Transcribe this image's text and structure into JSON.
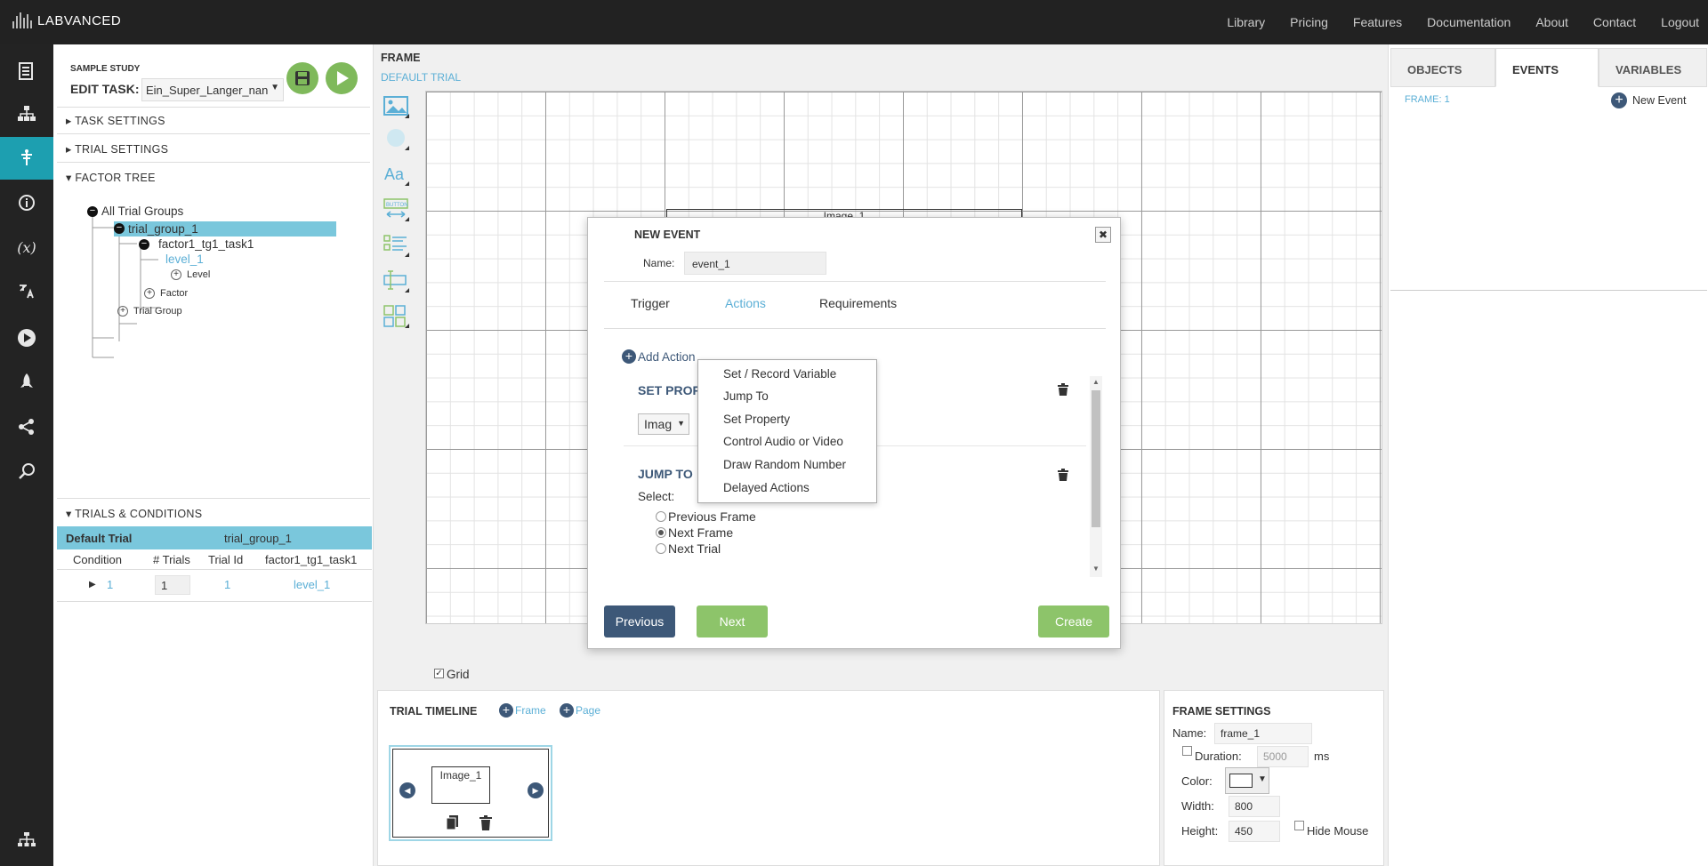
{
  "brand": {
    "name": "LABVANCED"
  },
  "topnav": [
    "Library",
    "Pricing",
    "Features",
    "Documentation",
    "About",
    "Contact",
    "Logout"
  ],
  "rail_icons": [
    "task-list-icon",
    "hierarchy-icon",
    "task-editor-icon",
    "info-icon",
    "variable-icon",
    "translate-icon",
    "play-icon",
    "rocket-icon",
    "share-icon",
    "search-icon",
    "sitemap-icon"
  ],
  "study": {
    "label": "SAMPLE STUDY",
    "edit_task_label": "EDIT TASK:",
    "task_name": "Ein_Super_Langer_nan"
  },
  "sections": {
    "task_settings": "TASK SETTINGS",
    "trial_settings": "TRIAL SETTINGS",
    "factor_tree": "FACTOR TREE",
    "trials_conditions": "TRIALS & CONDITIONS"
  },
  "factor_tree": {
    "root": "All Trial Groups",
    "group": "trial_group_1",
    "factor": "factor1_tg1_task1",
    "level": "level_1",
    "add_level": "Level",
    "add_factor": "Factor",
    "add_trial_group": "Trial Group"
  },
  "trials_table": {
    "group_title": "Default Trial",
    "group_name": "trial_group_1",
    "headers": [
      "Condition",
      "# Trials",
      "Trial Id",
      "factor1_tg1_task1"
    ],
    "rows": [
      {
        "condition": "1",
        "trials": "1",
        "trial_id": "1",
        "factor": "level_1"
      }
    ]
  },
  "frame": {
    "title": "FRAME",
    "subtitle": "DEFAULT TRIAL",
    "image_label": "Image_1",
    "grid_label": "Grid"
  },
  "right_tabs": [
    "OBJECTS",
    "EVENTS",
    "VARIABLES"
  ],
  "events_panel": {
    "frame_label": "FRAME: 1",
    "new_event": "New Event"
  },
  "modal": {
    "title": "NEW EVENT",
    "name_label": "Name:",
    "name_value": "event_1",
    "tabs": [
      "Trigger",
      "Actions",
      "Requirements"
    ],
    "add_action": "Add Action",
    "set_property_title": "SET PROP",
    "set_property_select": "Imag",
    "jump_to_title": "JUMP TO",
    "select_label": "Select:",
    "radio_options": [
      {
        "label": "Previous Frame",
        "checked": false
      },
      {
        "label": "Next Frame",
        "checked": true
      },
      {
        "label": "Next Trial",
        "checked": false
      }
    ],
    "buttons": {
      "previous": "Previous",
      "next": "Next",
      "create": "Create"
    }
  },
  "action_menu": [
    "Set / Record Variable",
    "Jump To",
    "Set Property",
    "Control Audio or Video",
    "Draw Random Number",
    "Delayed Actions"
  ],
  "timeline": {
    "title": "TRIAL TIMELINE",
    "add_frame": "Frame",
    "add_page": "Page",
    "thumb_label": "Image_1"
  },
  "frame_settings": {
    "title": "FRAME SETTINGS",
    "name_label": "Name:",
    "name_value": "frame_1",
    "duration_label": "Duration:",
    "duration_value": "5000",
    "duration_unit": "ms",
    "color_label": "Color:",
    "width_label": "Width:",
    "width_value": "800",
    "height_label": "Height:",
    "height_value": "450",
    "hide_mouse_label": "Hide Mouse"
  },
  "colors": {
    "accent": "#1d9fb0",
    "link": "#5bafd6",
    "primary_btn": "#3d5878",
    "green_btn": "#8dc46a",
    "highlight": "#7ac7dc"
  }
}
